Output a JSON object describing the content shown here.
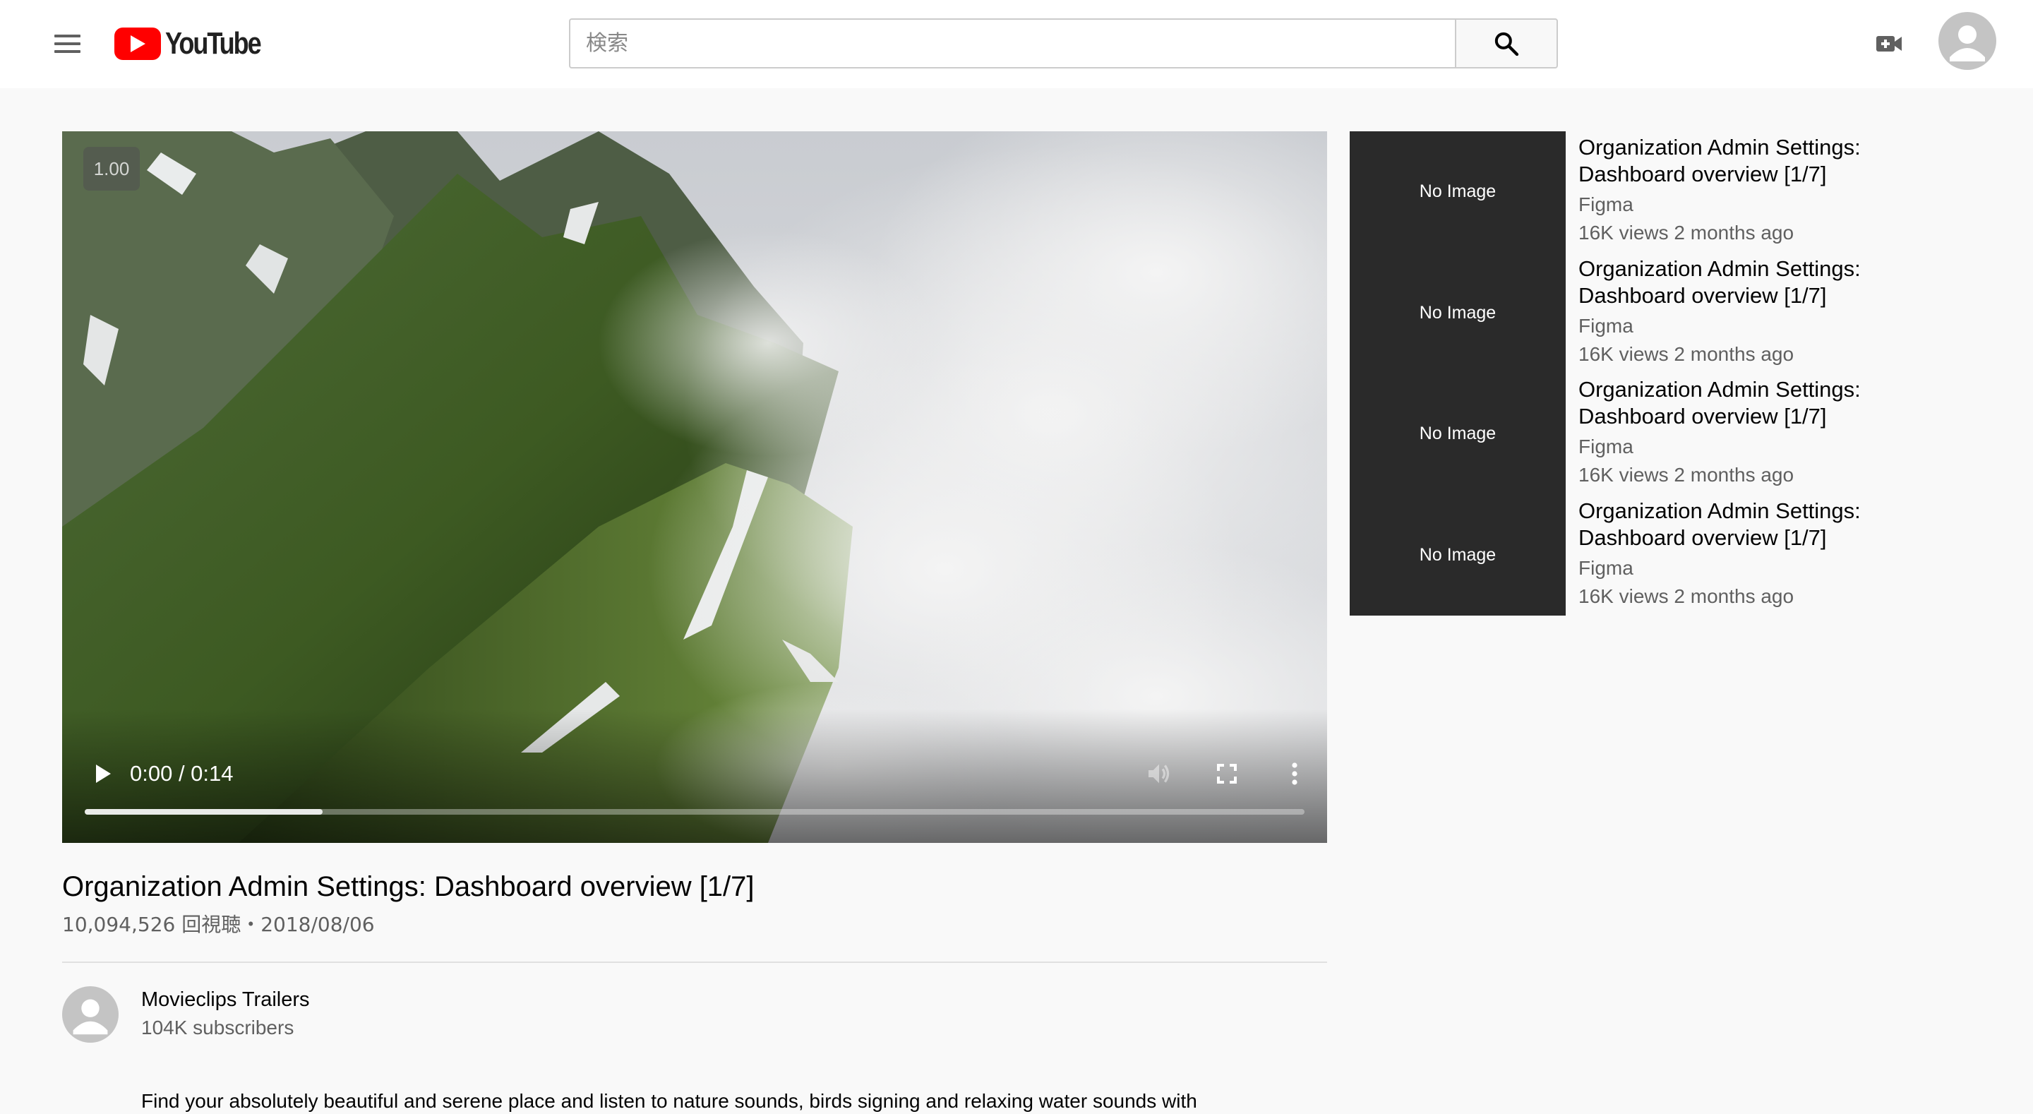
{
  "header": {
    "logo_text": "YouTube",
    "search_placeholder": "検索",
    "icons": {
      "menu": "hamburger-menu-icon",
      "search": "search-icon",
      "upload": "video-camera-icon",
      "account": "account-avatar-icon"
    }
  },
  "player": {
    "playback_speed": "1.00",
    "time": "0:00 / 0:14",
    "progress_fraction": 0.195,
    "icons": {
      "play": "play-icon",
      "volume": "volume-icon",
      "fullscreen": "fullscreen-icon",
      "more": "more-vert-icon"
    }
  },
  "video": {
    "title": "Organization Admin Settings: Dashboard overview [1/7]",
    "meta": "10,094,526 回視聴・2018/08/06"
  },
  "channel": {
    "name": "Movieclips Trailers",
    "subscribers": "104K subscribers"
  },
  "description": "Find your absolutely beautiful and serene place and listen to nature sounds, birds signing and relaxing water sounds with",
  "related": [
    {
      "thumb": "No Image",
      "title": "Organization Admin Settings: Dashboard overview [1/7]",
      "channel": "Figma",
      "meta": "16K views 2 months ago"
    },
    {
      "thumb": "No Image",
      "title": "Organization Admin Settings: Dashboard overview [1/7]",
      "channel": "Figma",
      "meta": "16K views 2 months ago"
    },
    {
      "thumb": "No Image",
      "title": "Organization Admin Settings: Dashboard overview [1/7]",
      "channel": "Figma",
      "meta": "16K views 2 months ago"
    },
    {
      "thumb": "No Image",
      "title": "Organization Admin Settings: Dashboard overview [1/7]",
      "channel": "Figma",
      "meta": "16K views 2 months ago"
    }
  ],
  "colors": {
    "brand_red": "#ff0000",
    "background": "#f9f9f9",
    "secondary_text": "#606060"
  }
}
